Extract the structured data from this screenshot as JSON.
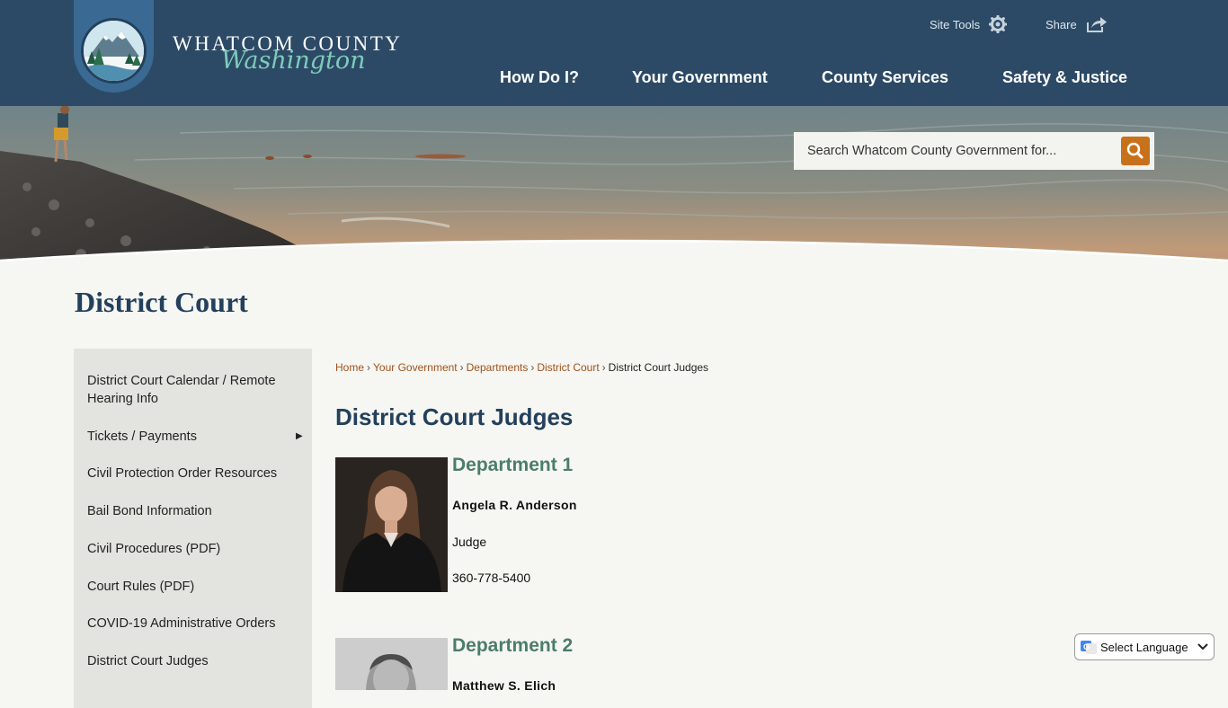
{
  "header": {
    "logo_title": "WHATCOM COUNTY",
    "logo_subtitle": "Washington",
    "site_tools_label": "Site Tools",
    "share_label": "Share",
    "nav": [
      "How Do I?",
      "Your Government",
      "County Services",
      "Safety & Justice"
    ]
  },
  "search": {
    "placeholder": "Search Whatcom County Government for..."
  },
  "page": {
    "title": "District Court"
  },
  "sidebar": {
    "items": [
      "District Court Calendar / Remote Hearing Info",
      "Tickets / Payments",
      "Civil Protection Order Resources",
      "Bail Bond Information",
      "Civil Procedures (PDF)",
      "Court Rules (PDF)",
      "COVID-19 Administrative Orders",
      "District Court Judges"
    ]
  },
  "breadcrumb": {
    "links": [
      "Home",
      "Your Government",
      "Departments",
      "District Court"
    ],
    "current": "District Court Judges"
  },
  "content": {
    "title": "District Court Judges",
    "judges": [
      {
        "department": "Department 1",
        "name": "Angela R. Anderson",
        "role": "Judge",
        "phone": "360-778-5400"
      },
      {
        "department": "Department 2",
        "name": "Matthew S. Elich"
      }
    ]
  },
  "translate": {
    "label": "Select Language"
  },
  "colors": {
    "header_bg": "#2c4a66",
    "accent": "#c8711b",
    "heading": "#23405c",
    "dept_heading": "#4b7d6c",
    "link": "#a0521d"
  }
}
